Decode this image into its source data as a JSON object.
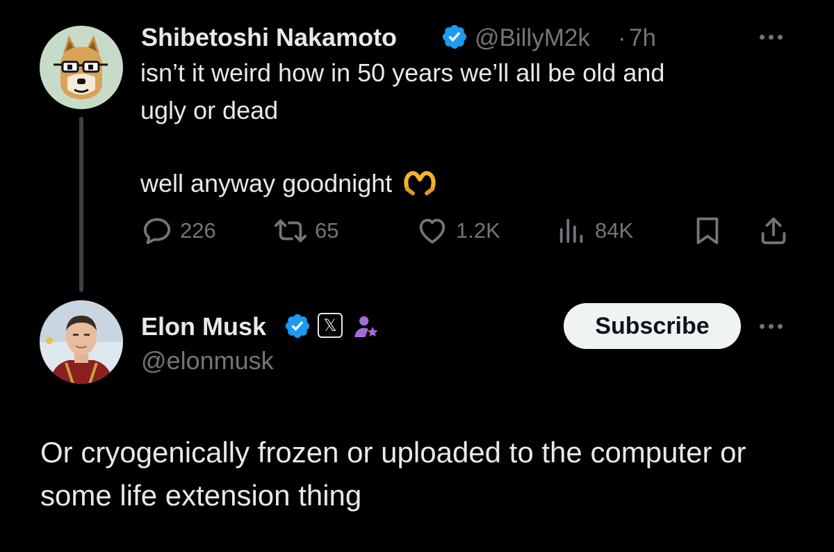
{
  "original_tweet": {
    "author_name": "Shibetoshi Nakamoto",
    "verified": true,
    "handle": "@BillyM2k",
    "separator": "·",
    "time": "7h",
    "text_line1": "isn’t it weird how in 50 years we’ll all be old and",
    "text_line2": "ugly or dead",
    "text_line3": "well anyway goodnight",
    "emoji": "🫶",
    "avatar_icon": "doge-with-glasses-avatar",
    "actions": {
      "replies": "226",
      "reposts": "65",
      "likes": "1.2K",
      "views": "84K"
    }
  },
  "reply_tweet": {
    "author_name": "Elon Musk",
    "verified": true,
    "affiliation_badge": "𝕏",
    "handle": "@elonmusk",
    "subscribe_label": "Subscribe",
    "text": "Or cryogenically frozen or uploaded to the computer or some life extension thing",
    "avatar_icon": "elon-musk-avatar"
  },
  "colors": {
    "background": "#000000",
    "text_primary": "#e7e9ea",
    "text_secondary": "#71767b",
    "verified_blue": "#1d9bf0",
    "subscribe_bg": "#eff3f4",
    "thread_line": "#3e4144",
    "subscriber_badge": "#a56bd8"
  }
}
